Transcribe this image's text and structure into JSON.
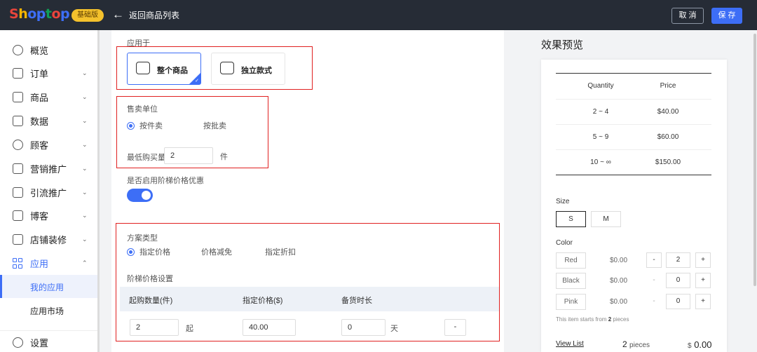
{
  "header": {
    "logo_letters": [
      {
        "ch": "S",
        "color": "#e8453c"
      },
      {
        "ch": "h",
        "color": "#f4b400"
      },
      {
        "ch": "o",
        "color": "#3d6ef6"
      },
      {
        "ch": "p",
        "color": "#3d6ef6"
      },
      {
        "ch": "t",
        "color": "#0f9d58"
      },
      {
        "ch": "o",
        "color": "#e8453c"
      },
      {
        "ch": "p",
        "color": "#3d6ef6"
      }
    ],
    "badge": "基础版",
    "back_label": "返回商品列表",
    "cancel_label": "取 消",
    "save_label": "保 存"
  },
  "sidebar": {
    "items": [
      {
        "label": "概览",
        "icon": "compass-icon"
      },
      {
        "label": "订单",
        "icon": "order-icon"
      },
      {
        "label": "商品",
        "icon": "product-icon"
      },
      {
        "label": "数据",
        "icon": "data-icon"
      },
      {
        "label": "顾客",
        "icon": "customer-icon"
      },
      {
        "label": "营销推广",
        "icon": "marketing-icon"
      },
      {
        "label": "引流推广",
        "icon": "traffic-icon"
      },
      {
        "label": "博客",
        "icon": "blog-icon"
      },
      {
        "label": "店铺装修",
        "icon": "store-decoration-icon"
      },
      {
        "label": "应用",
        "icon": "apps-icon"
      }
    ],
    "sub_items": [
      "我的应用",
      "应用市场"
    ],
    "settings_label": "设置"
  },
  "form": {
    "apply_to_label": "应用于",
    "apply_options": [
      "整个商品",
      "独立款式"
    ],
    "sale_unit_label": "售卖单位",
    "sale_unit_options": [
      "按件卖",
      "按批卖"
    ],
    "min_purchase_label": "最低购买量",
    "min_purchase_value": "2",
    "min_purchase_unit": "件",
    "tier_enable_label": "是否启用阶梯价格优惠",
    "plan_type_label": "方案类型",
    "plan_type_options": [
      "指定价格",
      "价格减免",
      "指定折扣"
    ],
    "tier_settings_label": "阶梯价格设置",
    "table_headers": [
      "起购数量(件)",
      "指定价格($)",
      "备货时长"
    ],
    "row": {
      "qty": "2",
      "qty_suffix": "起",
      "price": "40.00",
      "days": "0",
      "days_suffix": "天",
      "action": "-"
    }
  },
  "preview": {
    "title": "效果预览",
    "table_headers": [
      "Quantity",
      "Price"
    ],
    "rows": [
      {
        "qty": "2 ~ 4",
        "price": "$40.00"
      },
      {
        "qty": "5 ~ 9",
        "price": "$60.00"
      },
      {
        "qty": "10 ~ ∞",
        "price": "$150.00"
      }
    ],
    "size_label": "Size",
    "sizes": [
      "S",
      "M"
    ],
    "color_label": "Color",
    "colors": [
      {
        "name": "Red",
        "price": "$0.00",
        "qty": "2"
      },
      {
        "name": "Black",
        "price": "$0.00",
        "qty": "0"
      },
      {
        "name": "Pink",
        "price": "$0.00",
        "qty": "0"
      }
    ],
    "minus": "-",
    "plus": "+",
    "note_prefix": "This item starts from ",
    "note_count": "2",
    "note_suffix": " pieces",
    "view_list": "View List",
    "total_pieces": "2",
    "pieces_word": "pieces",
    "currency": "$",
    "total_amount": "0.00"
  }
}
